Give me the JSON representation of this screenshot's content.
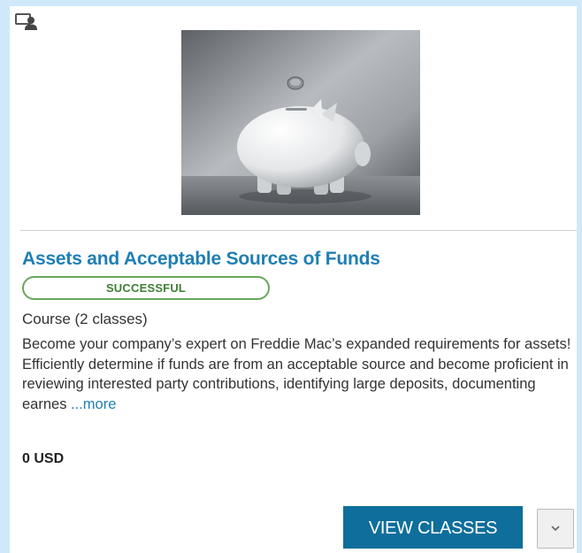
{
  "course": {
    "type_icon": "computer-user-icon",
    "thumbnail": "piggy-bank-with-coin",
    "title": "Assets and Acceptable Sources of Funds",
    "status": "SUCCESSFUL",
    "type_label": "Course (2 classes)",
    "description": "Become your company’s expert on Freddie Mac’s expanded requirements for assets!  Efficiently determine if funds are from an acceptable source and become proficient in reviewing interested party contributions, identifying large deposits, documenting earnes ",
    "more_label": "...more",
    "price": "0 USD"
  },
  "actions": {
    "view_classes_label": "VIEW CLASSES",
    "dropdown_icon": "chevron-down-icon"
  },
  "colors": {
    "accent": "#1f7fb3",
    "button": "#0f6e9b",
    "success": "#6aa65a",
    "page_bg": "#cfe9fb"
  }
}
